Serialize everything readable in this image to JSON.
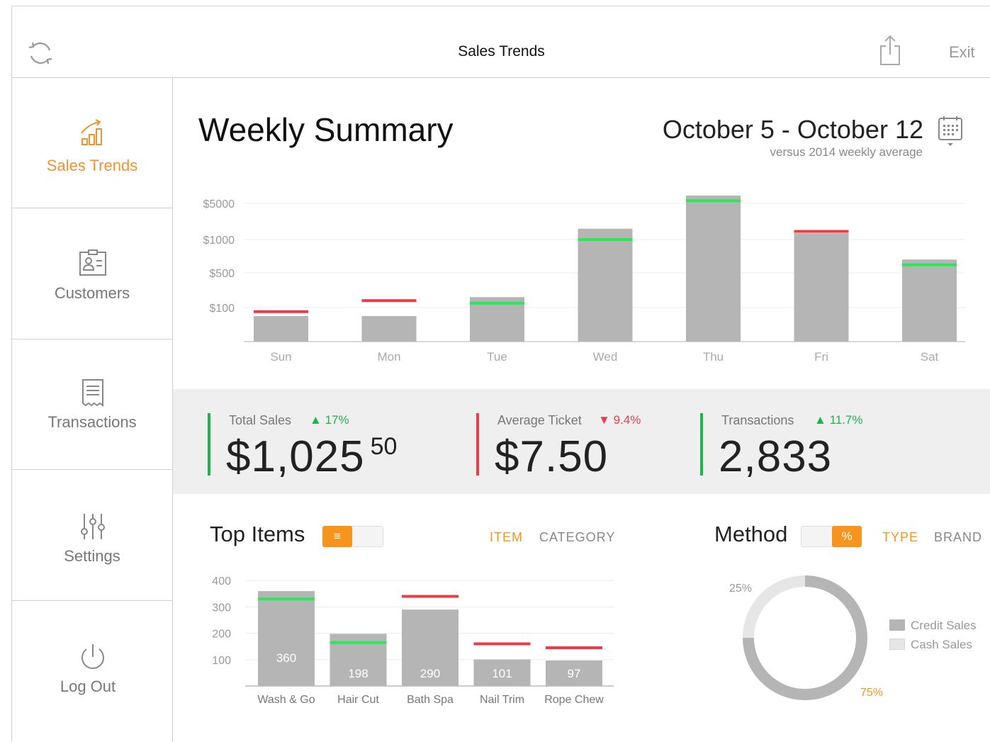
{
  "header": {
    "title": "Sales Trends",
    "exit_label": "Exit"
  },
  "sidebar": {
    "items": [
      {
        "label": "Sales Trends",
        "icon": "chart-trend-icon",
        "active": true
      },
      {
        "label": "Customers",
        "icon": "contact-card-icon",
        "active": false
      },
      {
        "label": "Transactions",
        "icon": "receipt-icon",
        "active": false
      },
      {
        "label": "Settings",
        "icon": "sliders-icon",
        "active": false
      },
      {
        "label": "Log Out",
        "icon": "power-icon",
        "active": false
      }
    ]
  },
  "summary": {
    "title": "Weekly Summary",
    "date_range": "October 5 - October 12",
    "comparison": "versus 2014 weekly average"
  },
  "stats": [
    {
      "label": "Total Sales",
      "delta": "17%",
      "direction": "up",
      "value": "$1,025",
      "cents": "50"
    },
    {
      "label": "Average Ticket",
      "delta": "9.4%",
      "direction": "down",
      "value": "$7.50",
      "cents": ""
    },
    {
      "label": "Transactions",
      "delta": "11.7%",
      "direction": "up",
      "value": "2,833",
      "cents": ""
    }
  ],
  "top_items": {
    "title": "Top Items",
    "tabs": [
      "ITEM",
      "CATEGORY"
    ],
    "active_tab": "ITEM"
  },
  "method": {
    "title": "Method",
    "toggle_label": "%",
    "tabs": [
      "TYPE",
      "BRAND"
    ],
    "active_tab": "TYPE"
  },
  "colors": {
    "accent": "#f7941d",
    "up": "#22b14c",
    "down": "#e8404a",
    "bar": "#b5b5b5",
    "marker_up": "#2ee65a",
    "marker_down": "#ee3a45"
  },
  "chart_data": [
    {
      "type": "bar",
      "title": "",
      "categories": [
        "Sun",
        "Mon",
        "Tue",
        "Wed",
        "Thu",
        "Fri",
        "Sat"
      ],
      "y_tick_labels": [
        "$100",
        "$500",
        "$1000",
        "$5000"
      ],
      "scale": "nonlinear",
      "series": [
        {
          "name": "",
          "values": [
            75,
            75,
            220,
            2200,
            6500,
            1700,
            700
          ]
        },
        {
          "name": "",
          "values": [
            88,
            180,
            150,
            1000,
            5500,
            1900,
            620
          ],
          "marker": "average-line"
        }
      ]
    },
    {
      "type": "bar",
      "title": "",
      "categories": [
        "Wash & Go",
        "Hair Cut",
        "Bath Spa",
        "Nail Trim",
        "Rope Chew"
      ],
      "ylim": [
        0,
        400
      ],
      "y_ticks": [
        100,
        200,
        300,
        400
      ],
      "series": [
        {
          "name": "",
          "values": [
            360,
            198,
            290,
            101,
            97
          ],
          "labels": [
            "360",
            "198",
            "290",
            "101",
            "97"
          ]
        },
        {
          "name": "",
          "values": [
            330,
            165,
            340,
            160,
            145
          ],
          "marker": "average-line"
        }
      ]
    },
    {
      "type": "pie",
      "title": "",
      "categories": [
        "Credit Sales",
        "Cash Sales"
      ],
      "values": [
        75,
        25
      ],
      "slice_labels": [
        "75%",
        "25%"
      ]
    }
  ]
}
